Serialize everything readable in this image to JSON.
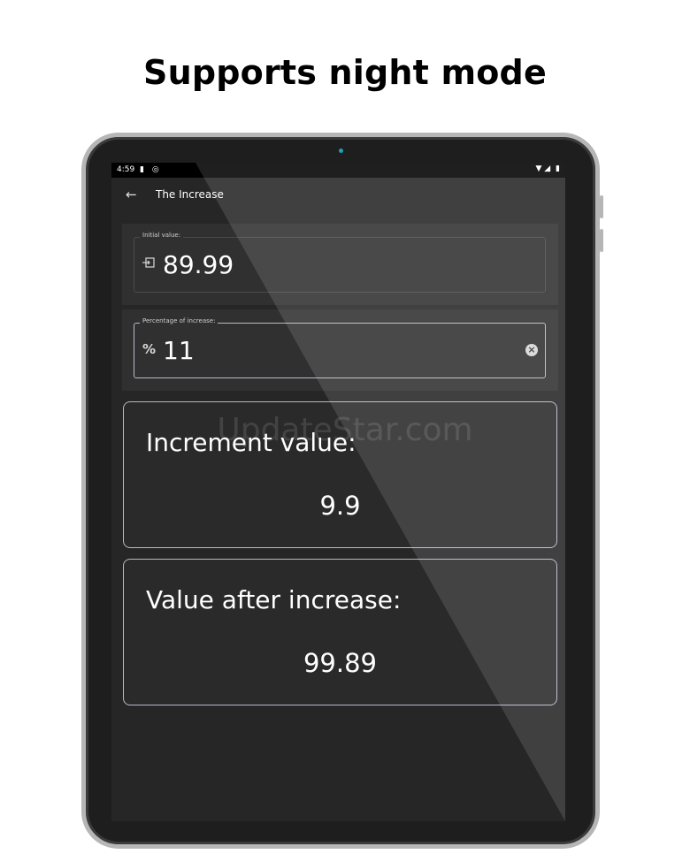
{
  "headline": "Supports night mode",
  "status_bar": {
    "time": "4:59",
    "left_icons": [
      "sd-card-icon",
      "sync-icon"
    ],
    "right_icons": [
      "wifi-icon",
      "signal-icon",
      "battery-icon"
    ]
  },
  "app_bar": {
    "title": "The Increase"
  },
  "initial_field": {
    "label": "Initial value:",
    "value": "89.99",
    "icon": "input-icon"
  },
  "percentage_field": {
    "label": "Percentage of increase:",
    "value": "11",
    "icon_glyph": "%",
    "icon": "percent-icon"
  },
  "increment_card": {
    "label": "Increment value:",
    "value": "9.9"
  },
  "after_card": {
    "label": "Value after increase:",
    "value": "99.89"
  },
  "watermark": "UpdateStar.com",
  "colors": {
    "screen_bg": "#262626",
    "panel_bg": "#303030",
    "card_border": "#b8b8cc",
    "text": "#ffffff"
  }
}
